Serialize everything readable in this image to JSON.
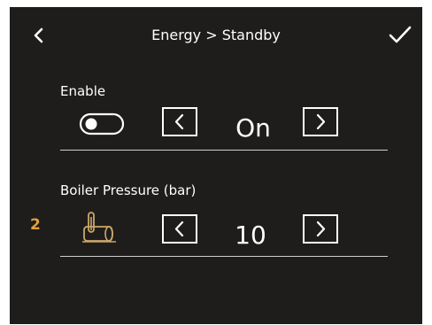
{
  "header": {
    "title": "Energy > Standby",
    "back_icon": "chevron-left-icon",
    "confirm_icon": "checkmark-icon"
  },
  "rows": [
    {
      "label": "Enable",
      "icon": "toggle-icon",
      "value": "On",
      "decrement_icon": "chevron-left-icon",
      "increment_icon": "chevron-right-icon"
    },
    {
      "label": "Boiler Pressure (bar)",
      "icon": "boiler-icon",
      "value": "10",
      "index": "2",
      "decrement_icon": "chevron-left-icon",
      "increment_icon": "chevron-right-icon"
    }
  ],
  "colors": {
    "background": "#1f1d1c",
    "text": "#ffffff",
    "accent": "#e0a23a",
    "divider": "#cfcfcf"
  }
}
